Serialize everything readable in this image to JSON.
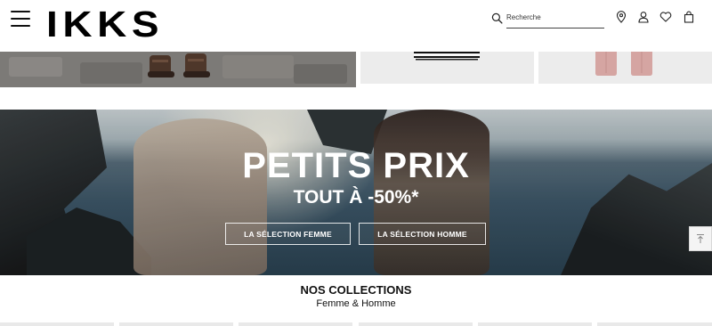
{
  "header": {
    "logo": "IKKS",
    "search_placeholder": "Recherche",
    "icons": [
      "menu-icon",
      "search-icon",
      "store-locator-icon",
      "account-icon",
      "wishlist-icon",
      "bag-icon"
    ]
  },
  "hero": {
    "title": "PETITS PRIX",
    "subtitle": "TOUT À -50%*",
    "buttons": {
      "women": "LA SÉLECTION FEMME",
      "men": "LA SÉLECTION HOMME"
    }
  },
  "collections": {
    "title": "NOS COLLECTIONS",
    "subtitle": "Femme & Homme"
  },
  "colors": {
    "text": "#111111",
    "background": "#ffffff",
    "tile_background": "#ececec"
  }
}
